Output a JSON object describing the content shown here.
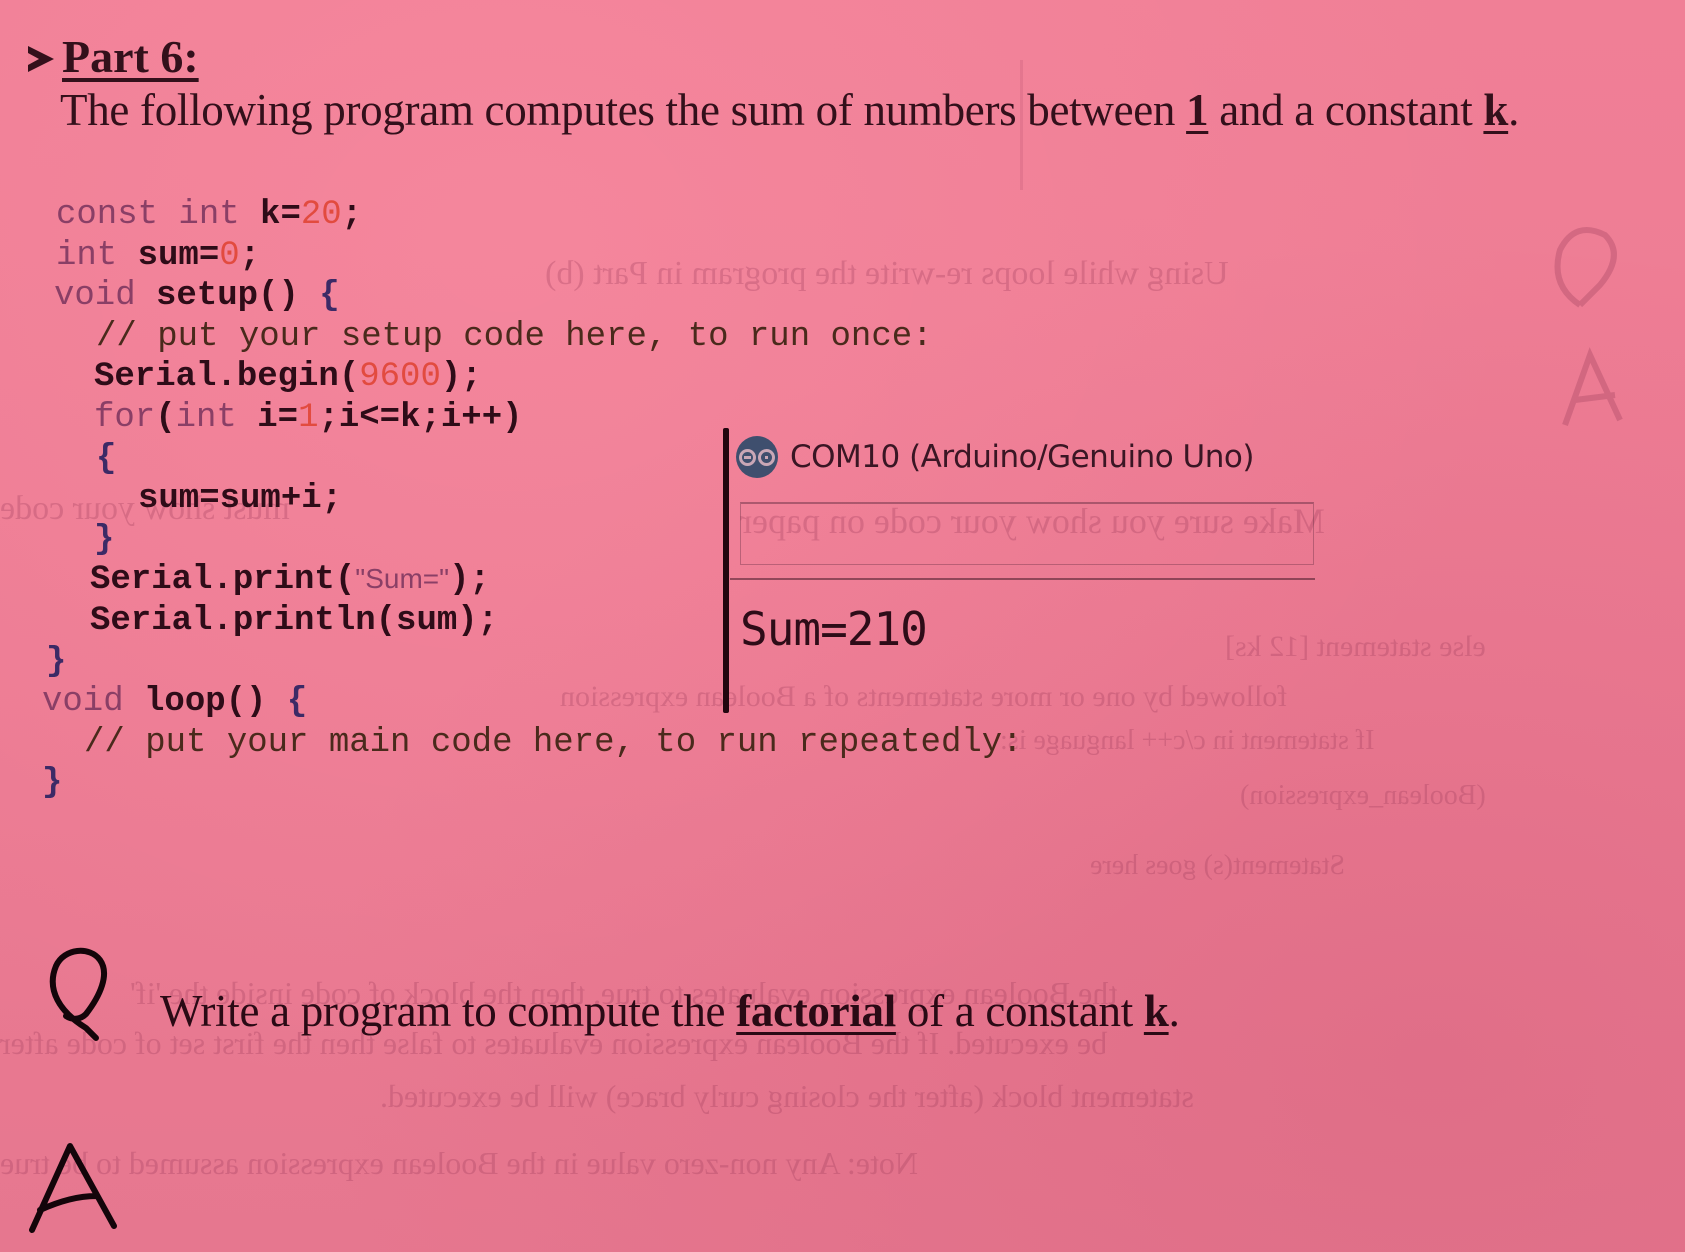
{
  "document": {
    "part_heading": "Part 6:",
    "intro": {
      "prefix": "The following program computes the sum of numbers between ",
      "start_value": "1",
      "middle": " and a constant ",
      "constant_name": "k",
      "suffix": "."
    }
  },
  "code": {
    "lines": [
      {
        "indent": "",
        "tokens": [
          [
            "kw",
            "const int "
          ],
          [
            "punc",
            "k="
          ],
          [
            "num",
            "20"
          ],
          [
            "punc",
            ";"
          ]
        ]
      },
      {
        "indent": "",
        "tokens": [
          [
            "kw",
            "int "
          ],
          [
            "punc",
            "sum="
          ],
          [
            "num",
            "0"
          ],
          [
            "punc",
            ";"
          ]
        ]
      },
      {
        "indent": "",
        "tokens": [
          [
            "kw",
            "void "
          ],
          [
            "punc",
            "setup() "
          ],
          [
            "brc",
            "{"
          ]
        ]
      },
      {
        "indent": "  ",
        "tokens": [
          [
            "cmt",
            "// put your setup code here, to run once:"
          ]
        ]
      },
      {
        "indent": "  ",
        "tokens": [
          [
            "punc",
            "Serial.begin("
          ],
          [
            "num",
            "9600"
          ],
          [
            "punc",
            ");"
          ]
        ]
      },
      {
        "indent": "  ",
        "tokens": [
          [
            "kw",
            "for"
          ],
          [
            "punc",
            "("
          ],
          [
            "kw",
            "int "
          ],
          [
            "punc",
            "i="
          ],
          [
            "num",
            "1"
          ],
          [
            "punc",
            ";i<=k;i++)"
          ]
        ]
      },
      {
        "indent": "  ",
        "tokens": [
          [
            "brc",
            "{"
          ]
        ]
      },
      {
        "indent": "    ",
        "tokens": [
          [
            "punc",
            "sum=sum+i;"
          ]
        ]
      },
      {
        "indent": "  ",
        "tokens": [
          [
            "brc",
            "}"
          ]
        ]
      },
      {
        "indent": "  ",
        "tokens": [
          [
            "punc",
            "Serial.print("
          ],
          [
            "str",
            "\"Sum=\""
          ],
          [
            "punc",
            ");"
          ]
        ]
      },
      {
        "indent": "  ",
        "tokens": [
          [
            "punc",
            "Serial.println(sum);"
          ]
        ]
      },
      {
        "indent": "",
        "tokens": [
          [
            "brc",
            "}"
          ]
        ]
      },
      {
        "indent": "",
        "tokens": [
          [
            "kw",
            "void "
          ],
          [
            "punc",
            "loop() "
          ],
          [
            "brc",
            "{"
          ]
        ]
      },
      {
        "indent": "  ",
        "tokens": [
          [
            "cmt",
            "// put your main code here, to run repeatedly:"
          ]
        ]
      },
      {
        "indent": "",
        "tokens": [
          [
            "brc",
            "}"
          ]
        ]
      }
    ]
  },
  "serial_monitor": {
    "icon": "arduino-logo-icon",
    "title": "COM10 (Arduino/Genuino Uno)",
    "input_value": "",
    "output": "Sum=210"
  },
  "question": {
    "marker": "Q",
    "prefix": "Write a program to compute the ",
    "emphasis": "factorial",
    "middle": " of a constant ",
    "constant_name": "k",
    "suffix": "."
  },
  "answer": {
    "marker": "A",
    "text": ""
  },
  "colors": {
    "paper": "#ee7f95",
    "ink": "#33101b",
    "keyword": "#8a3f66",
    "number": "#e24b3f",
    "comment": "#4a2a1c"
  }
}
